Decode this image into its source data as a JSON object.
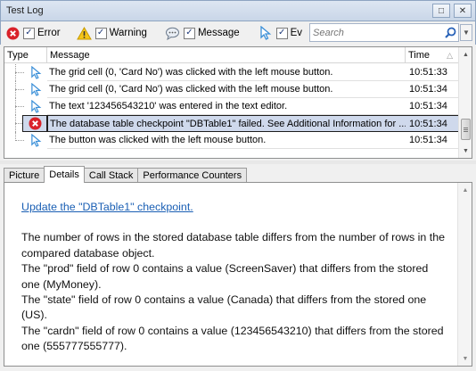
{
  "window": {
    "title": "Test Log",
    "restore_glyph": "□",
    "close_glyph": "✕"
  },
  "filters": [
    {
      "name": "error",
      "label": "Error",
      "checked": true,
      "icon": "error-icon"
    },
    {
      "name": "warning",
      "label": "Warning",
      "checked": true,
      "icon": "warning-icon"
    },
    {
      "name": "message",
      "label": "Message",
      "checked": true,
      "icon": "message-icon"
    },
    {
      "name": "event",
      "label": "Ev",
      "checked": true,
      "icon": "event-cursor-icon"
    }
  ],
  "search": {
    "placeholder": "Search"
  },
  "grid": {
    "columns": {
      "type": "Type",
      "message": "Message",
      "time": "Time"
    },
    "rows": [
      {
        "type": "event",
        "message": "The grid cell (0, 'Card No') was clicked with the left mouse button.",
        "time": "10:51:33"
      },
      {
        "type": "event",
        "message": "The grid cell (0, 'Card No') was clicked with the left mouse button.",
        "time": "10:51:34"
      },
      {
        "type": "event",
        "message": "The text '123456543210' was entered in the text editor.",
        "time": "10:51:34"
      },
      {
        "type": "error",
        "message": "The database table checkpoint \"DBTable1\" failed. See Additional Information for ...",
        "time": "10:51:34",
        "selected": true
      },
      {
        "type": "event",
        "message": "The button was clicked with the left mouse button.",
        "time": "10:51:34"
      }
    ]
  },
  "tabs": [
    {
      "label": "Picture",
      "active": false
    },
    {
      "label": "Details",
      "active": true
    },
    {
      "label": "Call Stack",
      "active": false
    },
    {
      "label": "Performance Counters",
      "active": false
    }
  ],
  "details": {
    "link": "Update the \"DBTable1\" checkpoint.",
    "paragraphs": [
      "The number of rows in the stored database table differs from the number of rows in the compared database object.",
      "The \"prod\" field of row 0 contains a value (ScreenSaver) that differs from the stored one (MyMoney).",
      "The \"state\" field of row 0 contains a value (Canada) that differs from the stored one (US).",
      "The \"cardn\" field of row 0 contains a value (123456543210) that differs from the stored one (555777555777)."
    ]
  },
  "colors": {
    "error": "#d9222a",
    "warning": "#f5c518",
    "selection": "#cfd9ec",
    "link": "#1a5fb4",
    "cursor": "#3a8fd8"
  }
}
